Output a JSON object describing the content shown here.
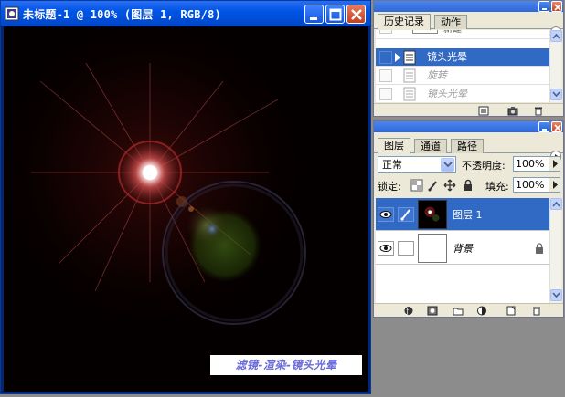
{
  "document": {
    "title": "未标题-1 @ 100% (图层 1, RGB/8)",
    "watermark": "滤镜-渲染-镜头光晕",
    "canvas_bg": "#050000",
    "flare_color": "#ff6a6a"
  },
  "history_panel": {
    "tabs": [
      {
        "label": "历史记录",
        "active": true
      },
      {
        "label": "动作",
        "active": false
      }
    ],
    "partial_top_label": "新建",
    "items": [
      {
        "label": "镜头光晕",
        "selected": true,
        "dimmed": false
      },
      {
        "label": "旋转",
        "selected": false,
        "dimmed": true
      },
      {
        "label": "镜头光晕",
        "selected": false,
        "dimmed": true
      }
    ]
  },
  "layers_panel": {
    "tabs": [
      {
        "label": "图层",
        "active": true
      },
      {
        "label": "通道",
        "active": false
      },
      {
        "label": "路径",
        "active": false
      }
    ],
    "blend_mode": "正常",
    "opacity_label": "不透明度:",
    "opacity_value": "100%",
    "lock_label": "锁定:",
    "fill_label": "填充:",
    "fill_value": "100%",
    "layers": [
      {
        "name": "图层 1",
        "selected": true,
        "visible": true
      },
      {
        "name": "背景",
        "selected": false,
        "visible": true,
        "locked": true
      }
    ]
  },
  "colors": {
    "titlebar": "#0055e5",
    "selection": "#316ac5",
    "panel_bg": "#ece9d8"
  }
}
